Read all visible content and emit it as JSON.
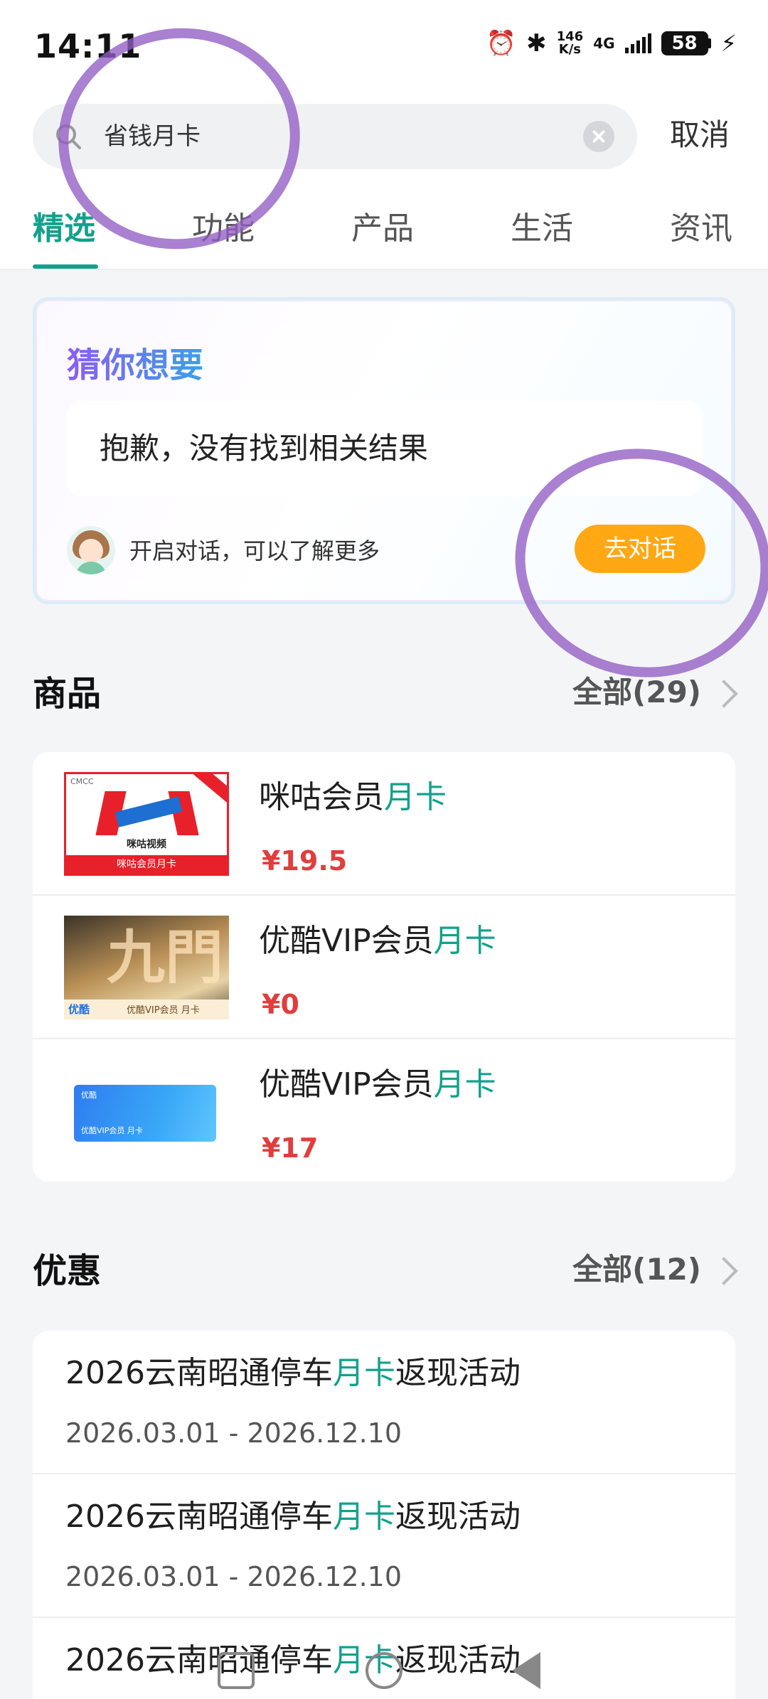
{
  "status_bar": {
    "time": "14:11",
    "net_speed_value": "146",
    "net_speed_unit": "K/s",
    "network_type": "4G",
    "battery": "58",
    "alarm_icon": "alarm-icon",
    "bluetooth_icon": "bluetooth-icon"
  },
  "search": {
    "query": "省钱月卡",
    "cancel_label": "取消"
  },
  "tabs": [
    {
      "label": "精选",
      "active": true
    },
    {
      "label": "功能",
      "active": false
    },
    {
      "label": "产品",
      "active": false
    },
    {
      "label": "生活",
      "active": false
    },
    {
      "label": "资讯",
      "active": false
    }
  ],
  "ai_card": {
    "title": "猜你想要",
    "result_text": "抱歉，没有找到相关结果",
    "hint": "开启对话，可以了解更多",
    "button_label": "去对话"
  },
  "products_section": {
    "title": "商品",
    "more_label": "全部(29)",
    "items": [
      {
        "name_prefix": "咪咕会员",
        "name_highlight": "月卡",
        "price": "¥19.5",
        "thumb_brand": "咪咕视频",
        "thumb_banner": "咪咕会员月卡"
      },
      {
        "name_prefix": "优酷VIP会员",
        "name_highlight": "月卡",
        "price": "¥0",
        "thumb_logo": "优酷",
        "thumb_text": "优酷VIP会员 月卡"
      },
      {
        "name_prefix": "优酷VIP会员",
        "name_highlight": "月卡",
        "price": "¥17",
        "thumb_logo": "优酷",
        "thumb_text": "优酷VIP会员 月卡"
      }
    ]
  },
  "promos_section": {
    "title": "优惠",
    "more_label": "全部(12)",
    "items": [
      {
        "title_prefix": "2026云南昭通停车",
        "title_highlight": "月卡",
        "title_suffix": "返现活动",
        "dates": "2026.03.01 - 2026.12.10"
      },
      {
        "title_prefix": "2026云南昭通停车",
        "title_highlight": "月卡",
        "title_suffix": "返现活动",
        "dates": "2026.03.01 - 2026.12.10"
      },
      {
        "title_prefix": "2026云南昭通停车",
        "title_highlight": "月卡",
        "title_suffix": "返现活动"
      }
    ]
  },
  "colors": {
    "accent": "#12a18c",
    "price": "#e23d3d",
    "chat_button": "#ffa814",
    "annotation": "#925cc4"
  }
}
